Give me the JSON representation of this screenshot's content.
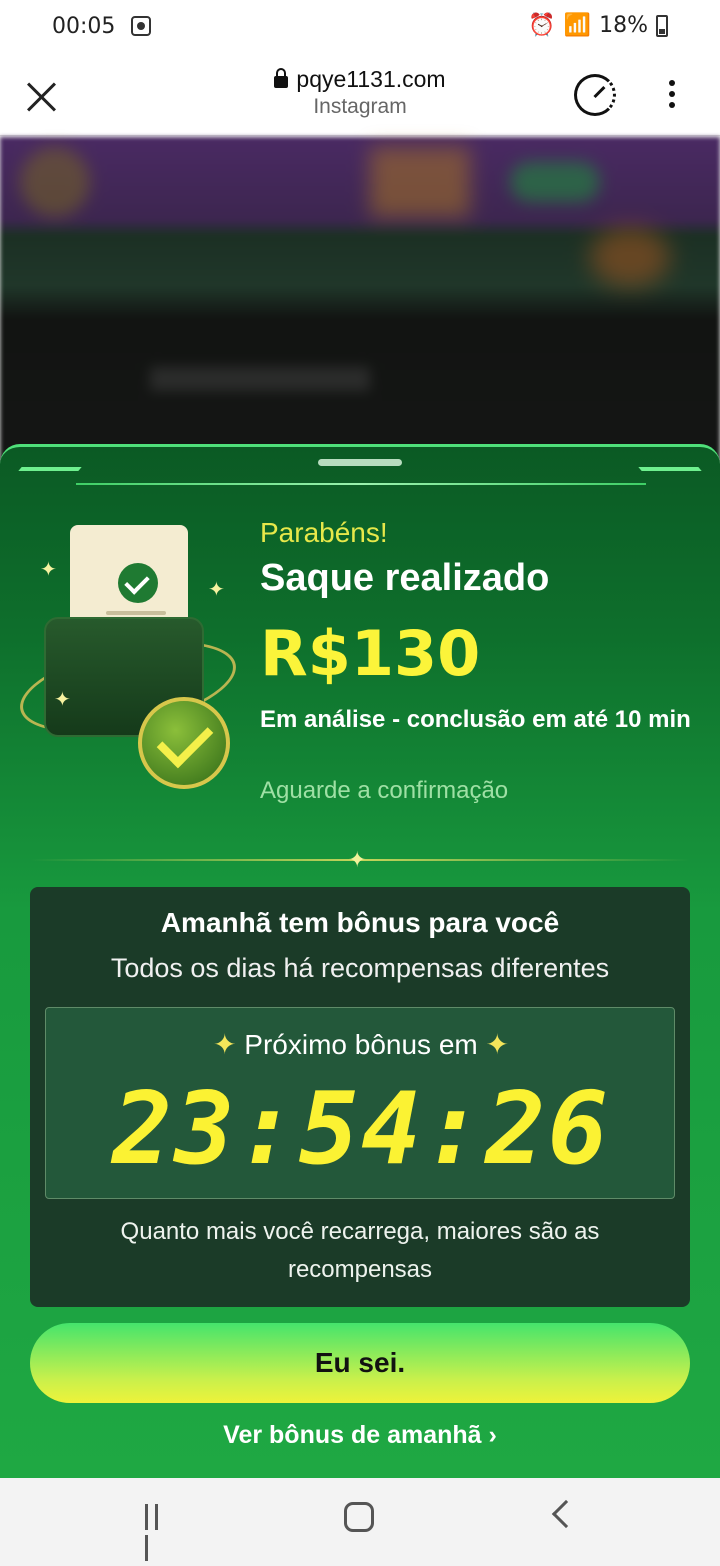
{
  "status_bar": {
    "time": "00:05",
    "battery": "18%"
  },
  "browser": {
    "url": "pqye1131.com",
    "subtitle": "Instagram"
  },
  "modal": {
    "congrats": "Parabéns!",
    "title": "Saque realizado",
    "amount": "R$130",
    "status": "Em análise - conclusão em até 10 min",
    "wait": "Aguarde a confirmação",
    "bonus_panel": {
      "title": "Amanhã tem bônus para você",
      "subtitle": "Todos os dias há recompensas diferentes",
      "timer_label": "Próximo bônus em",
      "countdown": "23:54:26",
      "note": "Quanto mais você recarrega, maiores são as recompensas"
    },
    "button_label": "Eu sei.",
    "link_label": "Ver bônus de amanhã ›"
  },
  "colors": {
    "accent_yellow": "#fbf43a",
    "sheet_green": "#1fa843",
    "panel_dark": "#1b3b28"
  }
}
